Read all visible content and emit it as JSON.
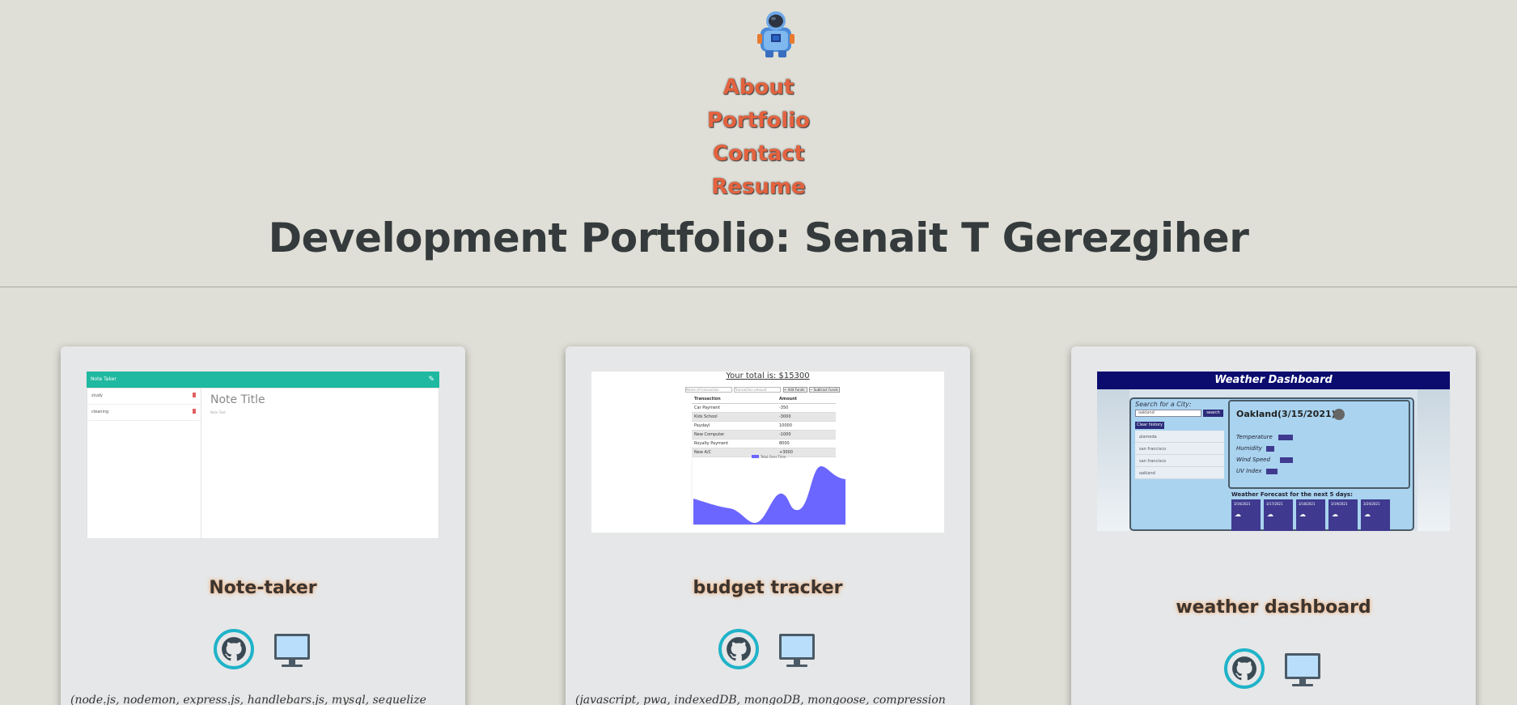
{
  "nav": {
    "items": [
      "About",
      "Portfolio",
      "Contact",
      "Resume"
    ]
  },
  "page_title": "Development Portfolio: Senait T Gerezgiher",
  "projects": [
    {
      "name": "Note-taker",
      "description": "(node.js, nodemon, express.js, handlebars.js, mysql, sequelize",
      "screenshot": {
        "bar_title": "Note Taker",
        "list_items": [
          "study",
          "cleaning"
        ],
        "note_title": "Note Title",
        "note_text": "Note Text"
      }
    },
    {
      "name": "budget tracker",
      "description": "(javascript, pwa, indexedDB, mongoDB, mongoose, compression",
      "screenshot": {
        "total": "Your total is: $15300",
        "name_placeholder": "Name of transaction",
        "amount_placeholder": "Transaction amount",
        "add_label": "+ Add Funds",
        "sub_label": "− Subtract Funds",
        "col_transaction": "Transaction",
        "col_amount": "Amount",
        "rows": [
          [
            "Car Payment",
            "-350"
          ],
          [
            "Kids School",
            "-3000"
          ],
          [
            "Paydayl",
            "10000"
          ],
          [
            "New Computer",
            "-1000"
          ],
          [
            "Royalty Payment",
            "8000"
          ],
          [
            "New A/C",
            "+3000"
          ]
        ],
        "legend": "Total Over Time"
      }
    },
    {
      "name": "weather dashboard",
      "description": "",
      "screenshot": {
        "header": "Weather Dashboard",
        "search_label": "Search for a City:",
        "search_value": "oakland",
        "search_button": "search",
        "clear_button": "Clear history",
        "history": [
          "alameda",
          "san francisco",
          "san francisco",
          "oakland"
        ],
        "city": "Oakland(3/15/2021)",
        "temp_label": "Temperature",
        "humidity_label": "Humidity",
        "wind_label": "Wind Speed",
        "uv_label": "UV Index",
        "forecast_title": "Weather Forecast for the next 5 days:",
        "forecast_dates": [
          "3/16/2021",
          "3/17/2021",
          "3/18/2021",
          "3/19/2021",
          "3/20/2021"
        ]
      }
    }
  ],
  "icons": {
    "repo": "github-icon",
    "deploy": "monitor-icon",
    "logo": "astronaut-icon"
  },
  "colors": {
    "nav_link": "#e4623e",
    "github_ring": "#1fb3c9",
    "note_bar": "#1fb8a0",
    "weather_header": "#0b0c6e",
    "chart_fill": "#6b66ff"
  }
}
